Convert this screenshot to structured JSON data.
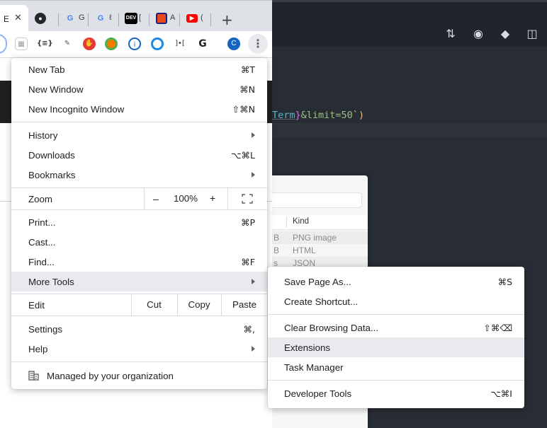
{
  "chrome": {
    "active_tab_title": "E",
    "tabs": [
      {
        "icon": "github-icon",
        "title": ""
      },
      {
        "icon": "google-icon",
        "title": "G"
      },
      {
        "icon": "google-icon",
        "title": "ℓ"
      },
      {
        "icon": "dev-icon",
        "title": "["
      },
      {
        "icon": "bookmark-site-icon",
        "title": "A"
      },
      {
        "icon": "youtube-icon",
        "title": "("
      }
    ],
    "new_tab_symbol": "+",
    "profile_initial": "C"
  },
  "menu": {
    "new_tab": {
      "label": "New Tab",
      "shortcut": "⌘T"
    },
    "new_window": {
      "label": "New Window",
      "shortcut": "⌘N"
    },
    "new_incognito": {
      "label": "New Incognito Window",
      "shortcut": "⇧⌘N"
    },
    "history": {
      "label": "History"
    },
    "downloads": {
      "label": "Downloads",
      "shortcut": "⌥⌘L"
    },
    "bookmarks": {
      "label": "Bookmarks"
    },
    "zoom": {
      "label": "Zoom",
      "minus": "–",
      "value": "100%",
      "plus": "+"
    },
    "print": {
      "label": "Print...",
      "shortcut": "⌘P"
    },
    "cast": {
      "label": "Cast..."
    },
    "find": {
      "label": "Find...",
      "shortcut": "⌘F"
    },
    "more_tools": {
      "label": "More Tools"
    },
    "edit": {
      "label": "Edit",
      "cut": "Cut",
      "copy": "Copy",
      "paste": "Paste"
    },
    "settings": {
      "label": "Settings",
      "shortcut": "⌘,"
    },
    "help": {
      "label": "Help"
    },
    "managed": {
      "label": "Managed by your organization"
    }
  },
  "submenu": {
    "save_page": {
      "label": "Save Page As...",
      "shortcut": "⌘S"
    },
    "create_shortcut": {
      "label": "Create Shortcut..."
    },
    "clear_browsing": {
      "label": "Clear Browsing Data...",
      "shortcut": "⇧⌘⌫"
    },
    "extensions": {
      "label": "Extensions"
    },
    "task_manager": {
      "label": "Task Manager"
    },
    "developer_tools": {
      "label": "Developer Tools",
      "shortcut": "⌥⌘I"
    }
  },
  "editor": {
    "code_prefix": "Term",
    "code_brace": "}",
    "code_string": "&limit=50",
    "code_tick": "`",
    "code_paren": ")"
  },
  "finder": {
    "kind_header": "Kind",
    "rows": [
      {
        "size": "B",
        "kind": "PNG image"
      },
      {
        "size": "B",
        "kind": "HTML"
      },
      {
        "size": "s",
        "kind": "JSON"
      }
    ]
  },
  "colors": {
    "menu_highlight": "#e8eaed",
    "editor_bg": "#282c34",
    "youtube": "#ff0000"
  }
}
